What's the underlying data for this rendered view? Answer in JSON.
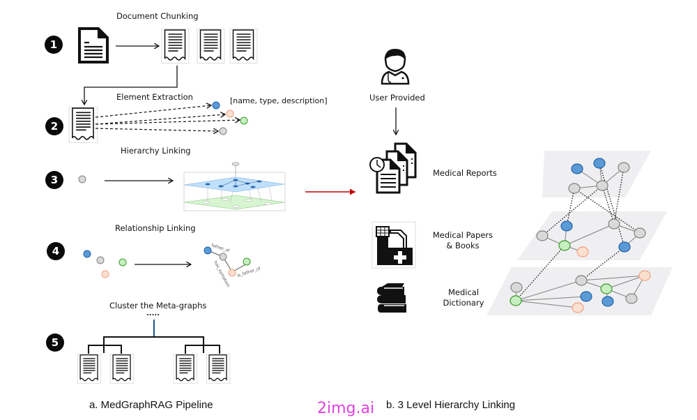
{
  "pipeline": {
    "steps": [
      {
        "number": "1",
        "title": "Document Chunking"
      },
      {
        "number": "2",
        "title": "Element Extraction",
        "element_schema": "[name, type, description]"
      },
      {
        "number": "3",
        "title": "Hierarchy Linking"
      },
      {
        "number": "4",
        "title": "Relationship Linking",
        "relations": [
          "father_of",
          "has_symptom",
          "is_father_of"
        ]
      },
      {
        "number": "5",
        "title": "Cluster the Meta-graphs",
        "ellipsis": "....."
      }
    ],
    "caption": "a. MedGraphRAG Pipeline"
  },
  "hierarchy": {
    "user_label": "User Provided",
    "levels": [
      {
        "label": "Medical Reports"
      },
      {
        "label_line1": "Medical Papers",
        "label_line2": "& Books"
      },
      {
        "label_line1": "Medical",
        "label_line2": "Dictionary"
      }
    ],
    "caption": "b. 3 Level Hierarchy Linking"
  },
  "watermark": "2img.ai",
  "colors": {
    "node_blue": "#5b9bd5",
    "node_blue_stroke": "#1f5fa8",
    "node_green": "#c6efc0",
    "node_green_stroke": "#3a9a2a",
    "node_orange": "#fbe0d0",
    "node_orange_stroke": "#f0a080",
    "node_gray": "#d9d9d9",
    "node_gray_stroke": "#808080",
    "arrow_red": "#c00000",
    "layer_fill": "#efeff1",
    "layer_blue": "#bfe0fb",
    "layer_green": "#d6f5d0"
  }
}
